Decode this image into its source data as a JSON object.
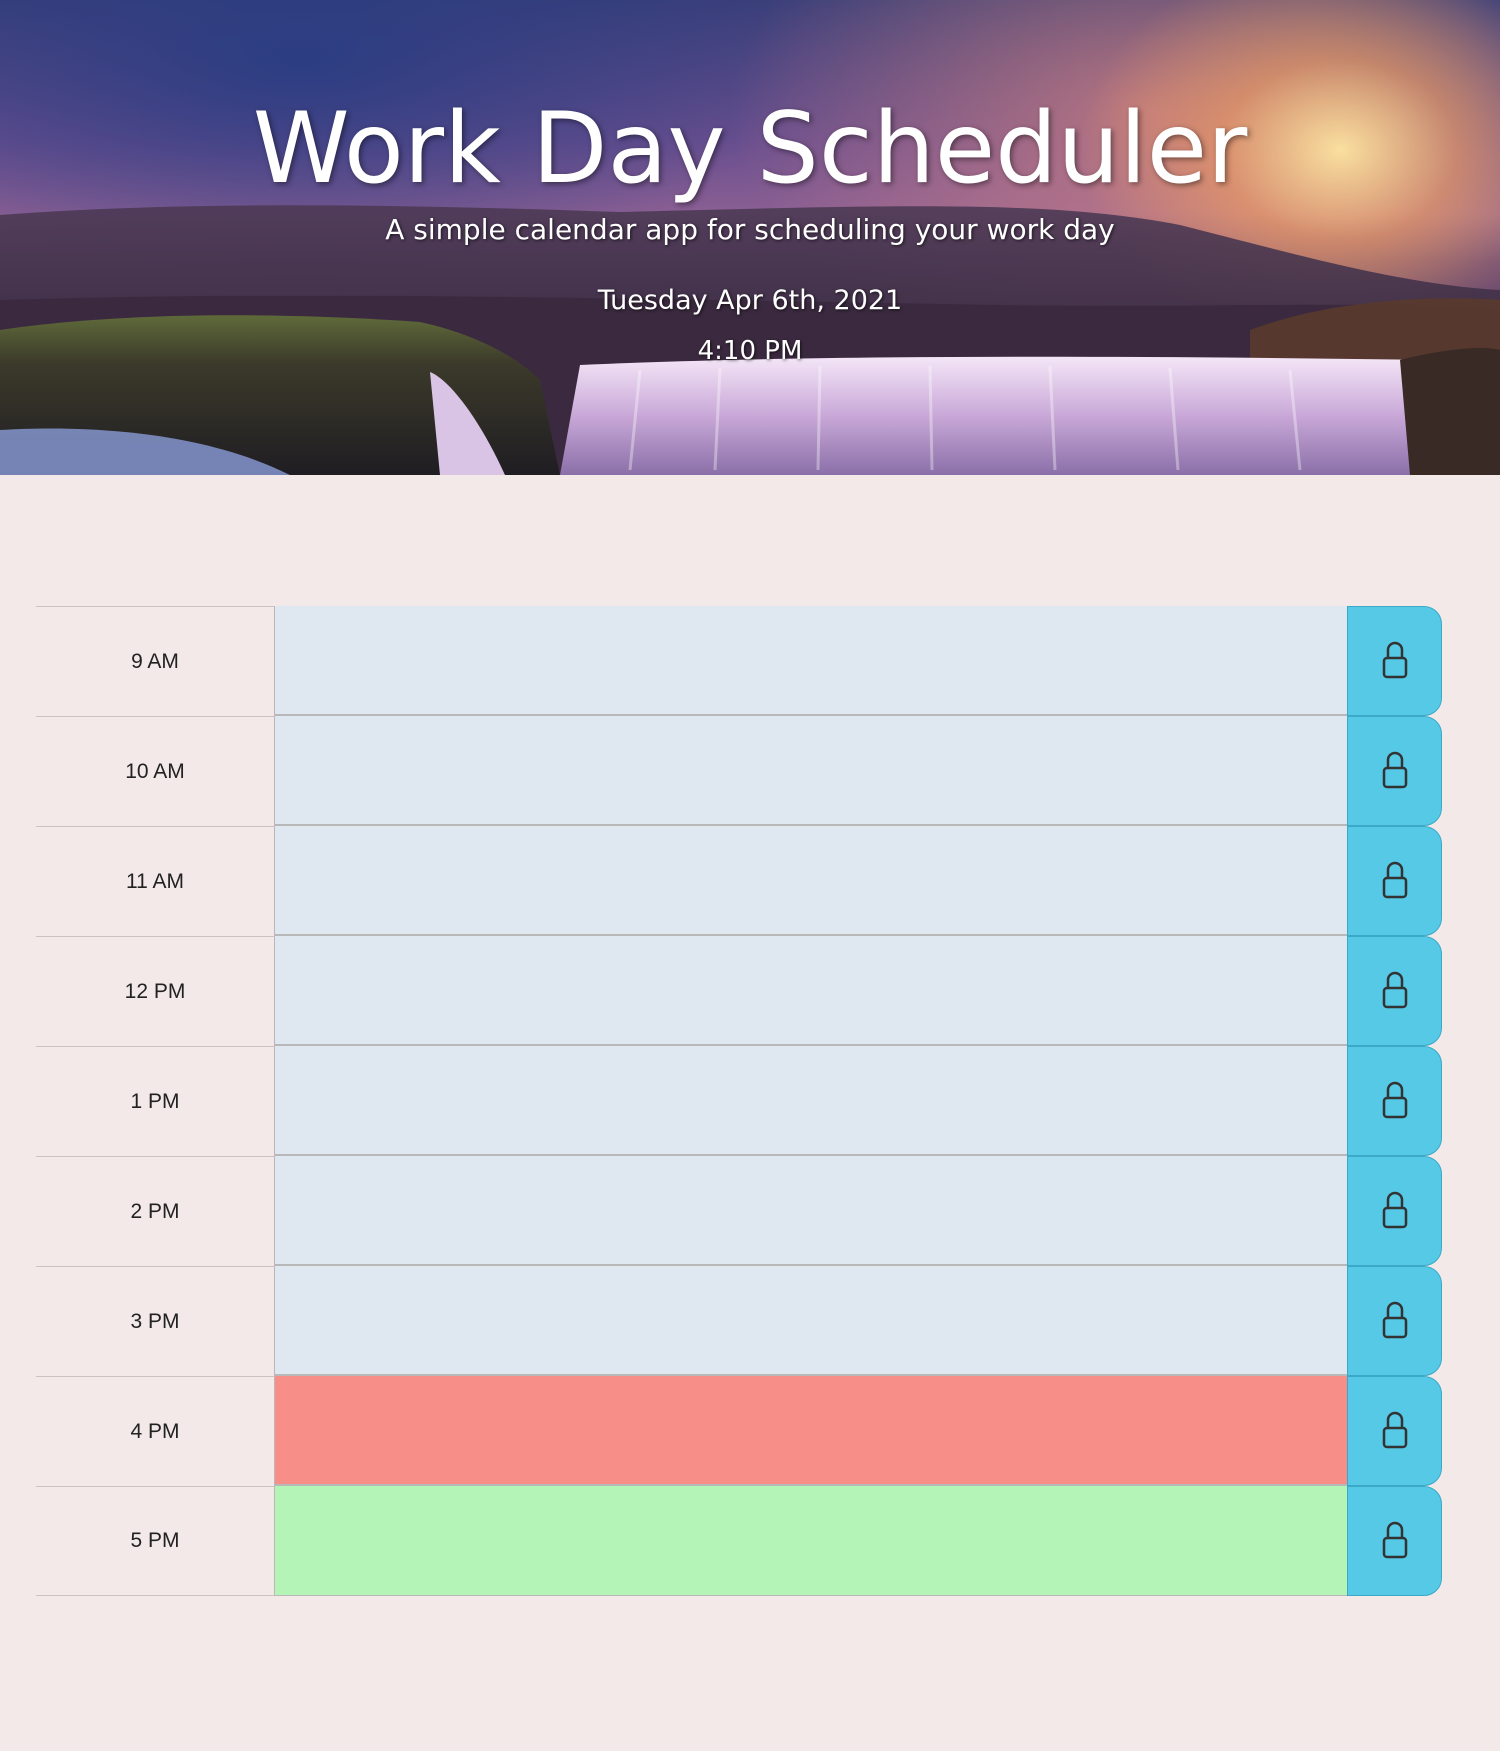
{
  "header": {
    "title": "Work Day Scheduler",
    "subtitle": "A simple calendar app for scheduling your work day",
    "date": "Tuesday Apr 6th, 2021",
    "time": "4:10 PM"
  },
  "colors": {
    "past": "#dfe8f1",
    "present": "#f78f88",
    "future": "#b5f4b7",
    "save_button": "#55c9e6",
    "page_background": "#f3e9e9"
  },
  "save_icon": "lock-icon",
  "time_blocks": [
    {
      "hour": "9 AM",
      "status": "past",
      "text": ""
    },
    {
      "hour": "10 AM",
      "status": "past",
      "text": ""
    },
    {
      "hour": "11 AM",
      "status": "past",
      "text": ""
    },
    {
      "hour": "12 PM",
      "status": "past",
      "text": ""
    },
    {
      "hour": "1 PM",
      "status": "past",
      "text": ""
    },
    {
      "hour": "2 PM",
      "status": "past",
      "text": ""
    },
    {
      "hour": "3 PM",
      "status": "past",
      "text": ""
    },
    {
      "hour": "4 PM",
      "status": "present",
      "text": ""
    },
    {
      "hour": "5 PM",
      "status": "future",
      "text": ""
    }
  ]
}
